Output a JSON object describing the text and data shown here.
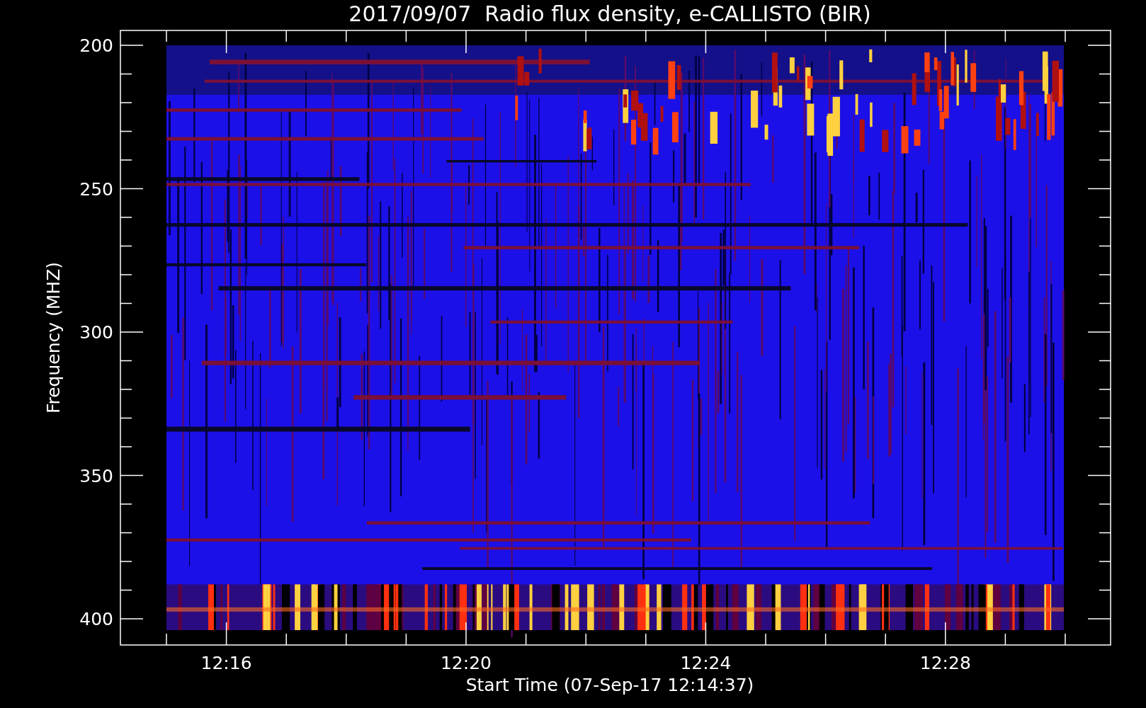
{
  "plot": {
    "title": "2017/09/07  Radio flux density, e-CALLISTO (BIR)",
    "ylabel": "Frequency (MHZ)",
    "xlabel": "Start Time (07-Sep-17 12:14:37)",
    "yticks": [
      "200",
      "250",
      "300",
      "350",
      "400"
    ],
    "xticks": [
      "12:16",
      "12:20",
      "12:24",
      "12:28"
    ]
  }
}
